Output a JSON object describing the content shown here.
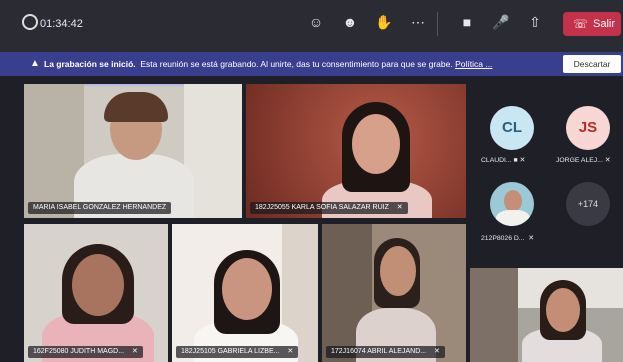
{
  "topbar": {
    "timer": "01:34:42",
    "leave_label": "Salir",
    "icons": [
      "participants-icon",
      "reactions-icon",
      "raise-hand-icon",
      "more-icon",
      "camera-icon",
      "mic-off-icon",
      "share-icon"
    ]
  },
  "banner": {
    "title": "La grabación se inició.",
    "message": "Esta reunión se está grabando. Al unirte, das tu consentimiento para que se grabe.",
    "link": "Política ...",
    "dismiss_label": "Descartar"
  },
  "tiles": [
    {
      "name": "MARIA ISABEL GONZALEZ HERNANDEZ"
    },
    {
      "name": "182J25055 KARLA SOFIA SALAZAR RUIZ"
    },
    {
      "name": "162F25080 JUDITH MAGD..."
    },
    {
      "name": "182J25105 GABRIELA LIZBE..."
    },
    {
      "name": "172J16074 ABRIL ALEJAND..."
    }
  ],
  "side": {
    "people": [
      {
        "initials": "CL",
        "label": "CLAUDI...",
        "color": "#2c5f7c",
        "bg": "#c9e6f3"
      },
      {
        "initials": "JS",
        "label": "JORGE ALEJ...",
        "color": "#b52d2a",
        "bg": "#f7d6d3"
      },
      {
        "initials": "",
        "label": "212P8026 D..."
      }
    ],
    "overflow": "+174"
  }
}
